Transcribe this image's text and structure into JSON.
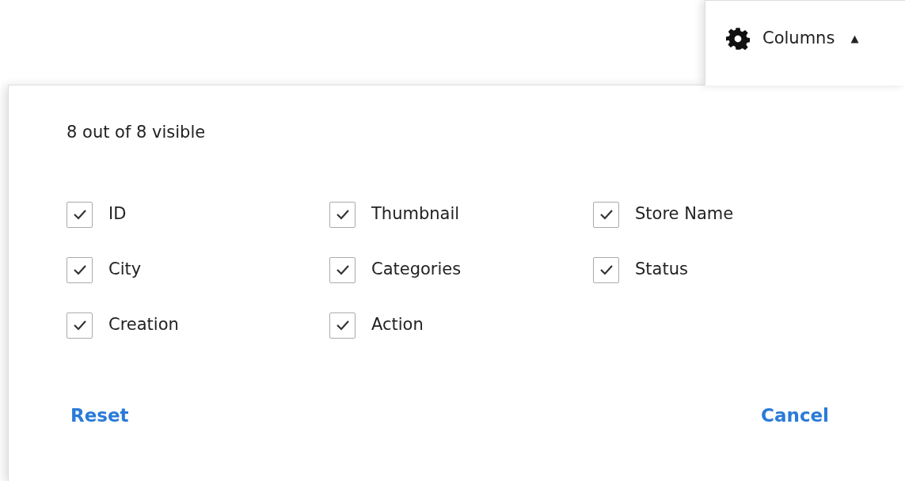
{
  "columns_button": {
    "label": "Columns",
    "caret": "▲",
    "expanded": true
  },
  "panel": {
    "summary": "8 out of 8 visible",
    "options": [
      {
        "label": "ID",
        "checked": true
      },
      {
        "label": "Thumbnail",
        "checked": true
      },
      {
        "label": "Store Name",
        "checked": true
      },
      {
        "label": "City",
        "checked": true
      },
      {
        "label": "Categories",
        "checked": true
      },
      {
        "label": "Status",
        "checked": true
      },
      {
        "label": "Creation",
        "checked": true
      },
      {
        "label": "Action",
        "checked": true
      }
    ],
    "reset": "Reset",
    "cancel": "Cancel"
  }
}
